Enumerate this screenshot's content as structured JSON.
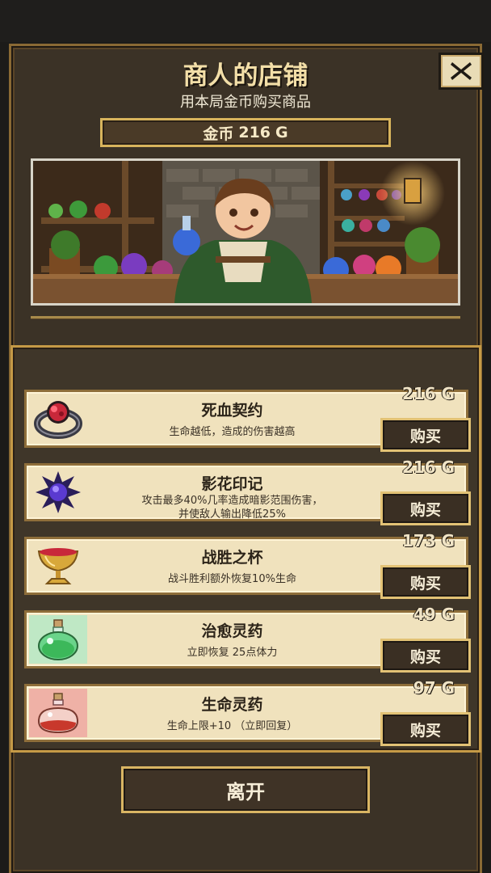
{
  "header": {
    "title": "商人的店铺",
    "subtitle": "用本局金币购买商品",
    "close_icon": "close-icon"
  },
  "gold": {
    "label": "金币",
    "amount": "216",
    "unit": "G"
  },
  "scene": {
    "image": "merchant-shop-illustration"
  },
  "items": [
    {
      "name": "死血契约",
      "desc": "生命越低，造成的伤害越高",
      "price": "216 G",
      "buy_label": "购买",
      "icon": "blood-ring-icon",
      "icon_bg": "#f0e2bd"
    },
    {
      "name": "影花印记",
      "desc": "攻击最多40%几率造成暗影范围伤害，\n并使敌人输出降低25%",
      "price": "216 G",
      "buy_label": "购买",
      "icon": "shadow-flower-icon",
      "icon_bg": "#f0e2bd"
    },
    {
      "name": "战胜之杯",
      "desc": "战斗胜利额外恢复10%生命",
      "price": "173 G",
      "buy_label": "购买",
      "icon": "golden-cup-icon",
      "icon_bg": "#f0e2bd"
    },
    {
      "name": "治愈灵药",
      "desc": "立即恢复 25点体力",
      "price": "49 G",
      "buy_label": "购买",
      "icon": "green-potion-icon",
      "icon_bg": "#bfe8c5"
    },
    {
      "name": "生命灵药",
      "desc": "生命上限+10  （立即回复）",
      "price": "97 G",
      "buy_label": "购买",
      "icon": "red-potion-icon",
      "icon_bg": "#efb1a6"
    }
  ],
  "footer": {
    "leave_label": "离开"
  }
}
